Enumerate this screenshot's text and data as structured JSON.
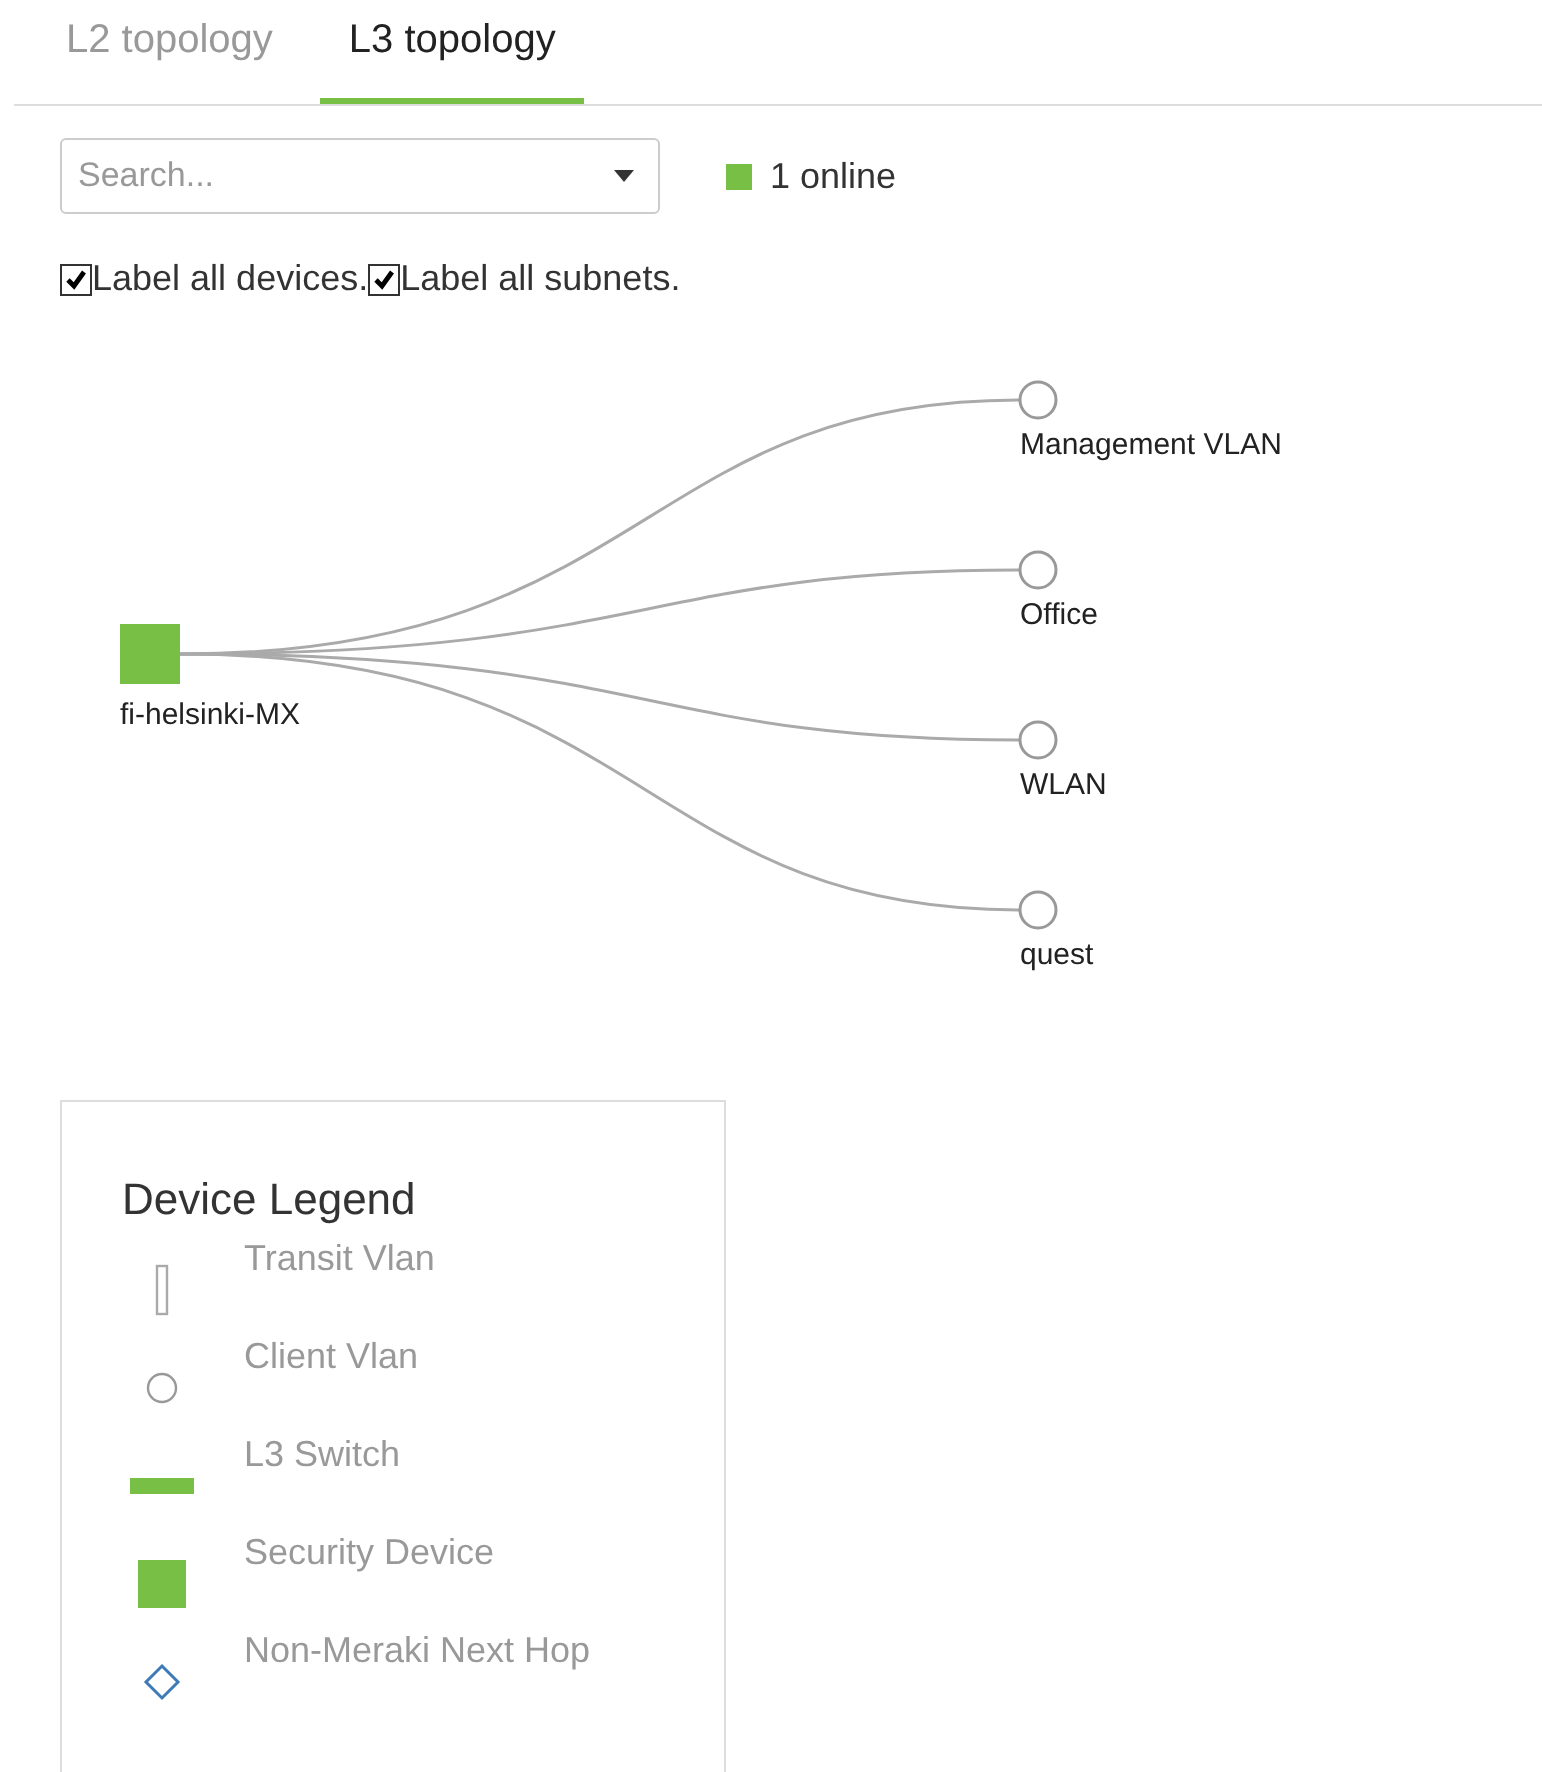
{
  "tabs": [
    {
      "label": "L2 topology",
      "selected": false
    },
    {
      "label": "L3 topology",
      "selected": true
    }
  ],
  "search": {
    "placeholder": "Search..."
  },
  "online": {
    "label": "1 online",
    "color": "#77bf45"
  },
  "options": [
    {
      "label": "Label all devices.",
      "checked": true
    },
    {
      "label": "Label all subnets.",
      "checked": true
    }
  ],
  "topology": {
    "device": {
      "label": "fi-helsinki-MX",
      "kind": "security"
    },
    "subnets": [
      {
        "label": "Management VLAN"
      },
      {
        "label": "Office"
      },
      {
        "label": "WLAN"
      },
      {
        "label": "quest"
      }
    ]
  },
  "legend": {
    "title": "Device Legend",
    "items": [
      {
        "kind": "transit",
        "label": "Transit Vlan"
      },
      {
        "kind": "client",
        "label": "Client Vlan"
      },
      {
        "kind": "l3switch",
        "label": "L3 Switch"
      },
      {
        "kind": "security",
        "label": "Security Device"
      },
      {
        "kind": "nonmeraki",
        "label": "Non-Meraki Next Hop"
      }
    ]
  }
}
